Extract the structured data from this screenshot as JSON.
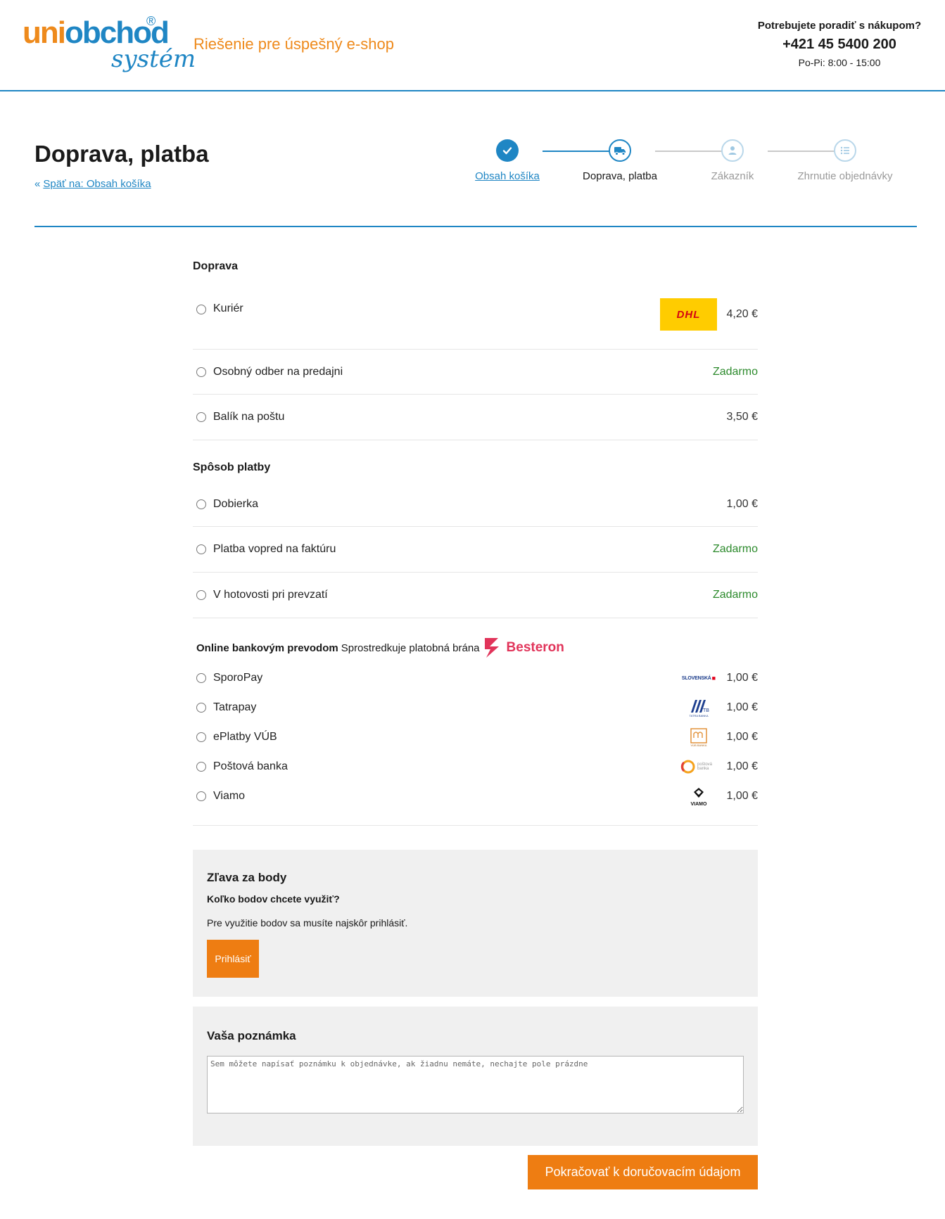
{
  "header": {
    "logo_text_uni": "uni",
    "logo_text_obchod": "obchod",
    "logo_text_system": "systém",
    "logo_registered": "®",
    "tagline": "Riešenie pre úspešný e-shop",
    "contact_question": "Potrebujete poradiť s nákupom?",
    "contact_phone": "+421 45 5400 200",
    "contact_hours": "Po-Pi: 8:00 - 15:00"
  },
  "page": {
    "title": "Doprava, platba",
    "back_link": "Späť na: Obsah košíka"
  },
  "stepper": [
    {
      "label": "Obsah košíka",
      "state": "done",
      "icon": "check-icon"
    },
    {
      "label": "Doprava, platba",
      "state": "active",
      "icon": "truck-icon"
    },
    {
      "label": "Zákazník",
      "state": "future",
      "icon": "user-icon"
    },
    {
      "label": "Zhrnutie objednávky",
      "state": "future",
      "icon": "list-icon"
    }
  ],
  "shipping": {
    "title": "Doprava",
    "options": [
      {
        "label": "Kuriér",
        "price": "4,20 €",
        "logo": "dhl-logo",
        "logo_text": "DHL"
      },
      {
        "label": "Osobný odber na predajni",
        "price": "Zadarmo"
      },
      {
        "label": "Balík na poštu",
        "price": "3,50 €"
      }
    ]
  },
  "payment": {
    "title": "Spôsob platby",
    "options": [
      {
        "label": "Dobierka",
        "price": "1,00 €"
      },
      {
        "label": "Platba vopred na faktúru",
        "price": "Zadarmo"
      },
      {
        "label": "V hotovosti pri prevzatí",
        "price": "Zadarmo"
      }
    ]
  },
  "online_bank": {
    "heading_bold": "Online bankovým prevodom",
    "heading_text": "Sprostredkuje platobná brána",
    "gateway_name": "Besteron",
    "options": [
      {
        "label": "SporoPay",
        "price": "1,00 €",
        "logo": "slovenska-sporitelna-logo",
        "logo_text": "SLOVENSKÁ"
      },
      {
        "label": "Tatrapay",
        "price": "1,00 €",
        "logo": "tatra-banka-logo",
        "logo_text": "TATRA BANKA"
      },
      {
        "label": "ePlatby VÚB",
        "price": "1,00 €",
        "logo": "vub-banka-logo",
        "logo_text": "VÚB BANKA"
      },
      {
        "label": "Poštová banka",
        "price": "1,00 €",
        "logo": "postova-banka-logo",
        "logo_text": "poštová banka"
      },
      {
        "label": "Viamo",
        "price": "1,00 €",
        "logo": "viamo-logo",
        "logo_text": "VIAMO"
      }
    ]
  },
  "points": {
    "title": "Zľava za body",
    "question": "Koľko bodov chcete využiť?",
    "info": "Pre využitie bodov sa musíte najskôr prihlásiť.",
    "login_button": "Prihlásiť"
  },
  "note": {
    "title": "Vaša poznámka",
    "placeholder": "Sem môžete napísať poznámku k objednávke, ak žiadnu nemáte, nechajte pole prázdne",
    "value": ""
  },
  "continue_button": "Pokračovať k doručovacím údajom",
  "colors": {
    "brand_blue": "#1f86c4",
    "brand_orange": "#ee7d12",
    "free_green": "#2c8a2c",
    "panel_gray": "#f0f0f0",
    "besteron_red": "#e1345a",
    "dhl_yellow": "#ffcc00",
    "dhl_red": "#d40511"
  }
}
